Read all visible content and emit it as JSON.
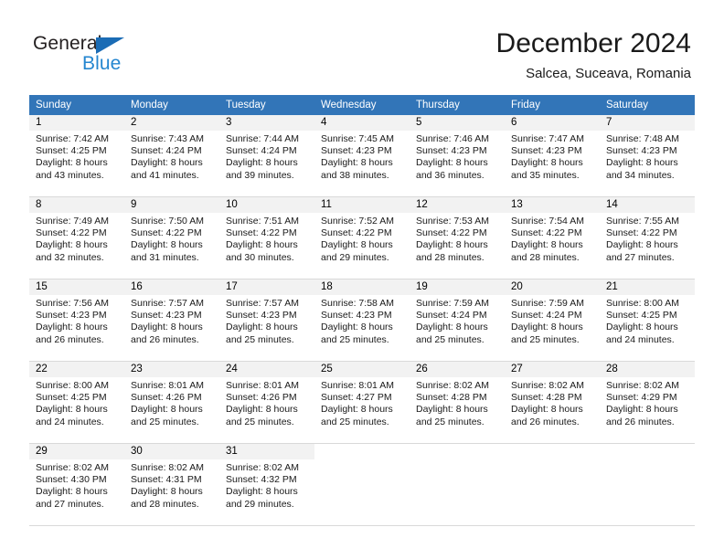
{
  "brand": {
    "name_part1": "General",
    "name_part2": "Blue",
    "triangle_color": "#1b6cb5",
    "blue_color": "#2486d0"
  },
  "header": {
    "title": "December 2024",
    "subtitle": "Salcea, Suceava, Romania",
    "header_bg_color": "#3275b8",
    "daynum_bg_color": "#f2f2f2"
  },
  "weekdays": [
    "Sunday",
    "Monday",
    "Tuesday",
    "Wednesday",
    "Thursday",
    "Friday",
    "Saturday"
  ],
  "labels": {
    "sunrise_prefix": "Sunrise:",
    "sunset_prefix": "Sunset:",
    "daylight_prefix": "Daylight:"
  },
  "weeks": [
    [
      {
        "day": "1",
        "sunrise": "Sunrise: 7:42 AM",
        "sunset": "Sunset: 4:25 PM",
        "daylight_l1": "Daylight: 8 hours",
        "daylight_l2": "and 43 minutes."
      },
      {
        "day": "2",
        "sunrise": "Sunrise: 7:43 AM",
        "sunset": "Sunset: 4:24 PM",
        "daylight_l1": "Daylight: 8 hours",
        "daylight_l2": "and 41 minutes."
      },
      {
        "day": "3",
        "sunrise": "Sunrise: 7:44 AM",
        "sunset": "Sunset: 4:24 PM",
        "daylight_l1": "Daylight: 8 hours",
        "daylight_l2": "and 39 minutes."
      },
      {
        "day": "4",
        "sunrise": "Sunrise: 7:45 AM",
        "sunset": "Sunset: 4:23 PM",
        "daylight_l1": "Daylight: 8 hours",
        "daylight_l2": "and 38 minutes."
      },
      {
        "day": "5",
        "sunrise": "Sunrise: 7:46 AM",
        "sunset": "Sunset: 4:23 PM",
        "daylight_l1": "Daylight: 8 hours",
        "daylight_l2": "and 36 minutes."
      },
      {
        "day": "6",
        "sunrise": "Sunrise: 7:47 AM",
        "sunset": "Sunset: 4:23 PM",
        "daylight_l1": "Daylight: 8 hours",
        "daylight_l2": "and 35 minutes."
      },
      {
        "day": "7",
        "sunrise": "Sunrise: 7:48 AM",
        "sunset": "Sunset: 4:23 PM",
        "daylight_l1": "Daylight: 8 hours",
        "daylight_l2": "and 34 minutes."
      }
    ],
    [
      {
        "day": "8",
        "sunrise": "Sunrise: 7:49 AM",
        "sunset": "Sunset: 4:22 PM",
        "daylight_l1": "Daylight: 8 hours",
        "daylight_l2": "and 32 minutes."
      },
      {
        "day": "9",
        "sunrise": "Sunrise: 7:50 AM",
        "sunset": "Sunset: 4:22 PM",
        "daylight_l1": "Daylight: 8 hours",
        "daylight_l2": "and 31 minutes."
      },
      {
        "day": "10",
        "sunrise": "Sunrise: 7:51 AM",
        "sunset": "Sunset: 4:22 PM",
        "daylight_l1": "Daylight: 8 hours",
        "daylight_l2": "and 30 minutes."
      },
      {
        "day": "11",
        "sunrise": "Sunrise: 7:52 AM",
        "sunset": "Sunset: 4:22 PM",
        "daylight_l1": "Daylight: 8 hours",
        "daylight_l2": "and 29 minutes."
      },
      {
        "day": "12",
        "sunrise": "Sunrise: 7:53 AM",
        "sunset": "Sunset: 4:22 PM",
        "daylight_l1": "Daylight: 8 hours",
        "daylight_l2": "and 28 minutes."
      },
      {
        "day": "13",
        "sunrise": "Sunrise: 7:54 AM",
        "sunset": "Sunset: 4:22 PM",
        "daylight_l1": "Daylight: 8 hours",
        "daylight_l2": "and 28 minutes."
      },
      {
        "day": "14",
        "sunrise": "Sunrise: 7:55 AM",
        "sunset": "Sunset: 4:22 PM",
        "daylight_l1": "Daylight: 8 hours",
        "daylight_l2": "and 27 minutes."
      }
    ],
    [
      {
        "day": "15",
        "sunrise": "Sunrise: 7:56 AM",
        "sunset": "Sunset: 4:23 PM",
        "daylight_l1": "Daylight: 8 hours",
        "daylight_l2": "and 26 minutes."
      },
      {
        "day": "16",
        "sunrise": "Sunrise: 7:57 AM",
        "sunset": "Sunset: 4:23 PM",
        "daylight_l1": "Daylight: 8 hours",
        "daylight_l2": "and 26 minutes."
      },
      {
        "day": "17",
        "sunrise": "Sunrise: 7:57 AM",
        "sunset": "Sunset: 4:23 PM",
        "daylight_l1": "Daylight: 8 hours",
        "daylight_l2": "and 25 minutes."
      },
      {
        "day": "18",
        "sunrise": "Sunrise: 7:58 AM",
        "sunset": "Sunset: 4:23 PM",
        "daylight_l1": "Daylight: 8 hours",
        "daylight_l2": "and 25 minutes."
      },
      {
        "day": "19",
        "sunrise": "Sunrise: 7:59 AM",
        "sunset": "Sunset: 4:24 PM",
        "daylight_l1": "Daylight: 8 hours",
        "daylight_l2": "and 25 minutes."
      },
      {
        "day": "20",
        "sunrise": "Sunrise: 7:59 AM",
        "sunset": "Sunset: 4:24 PM",
        "daylight_l1": "Daylight: 8 hours",
        "daylight_l2": "and 25 minutes."
      },
      {
        "day": "21",
        "sunrise": "Sunrise: 8:00 AM",
        "sunset": "Sunset: 4:25 PM",
        "daylight_l1": "Daylight: 8 hours",
        "daylight_l2": "and 24 minutes."
      }
    ],
    [
      {
        "day": "22",
        "sunrise": "Sunrise: 8:00 AM",
        "sunset": "Sunset: 4:25 PM",
        "daylight_l1": "Daylight: 8 hours",
        "daylight_l2": "and 24 minutes."
      },
      {
        "day": "23",
        "sunrise": "Sunrise: 8:01 AM",
        "sunset": "Sunset: 4:26 PM",
        "daylight_l1": "Daylight: 8 hours",
        "daylight_l2": "and 25 minutes."
      },
      {
        "day": "24",
        "sunrise": "Sunrise: 8:01 AM",
        "sunset": "Sunset: 4:26 PM",
        "daylight_l1": "Daylight: 8 hours",
        "daylight_l2": "and 25 minutes."
      },
      {
        "day": "25",
        "sunrise": "Sunrise: 8:01 AM",
        "sunset": "Sunset: 4:27 PM",
        "daylight_l1": "Daylight: 8 hours",
        "daylight_l2": "and 25 minutes."
      },
      {
        "day": "26",
        "sunrise": "Sunrise: 8:02 AM",
        "sunset": "Sunset: 4:28 PM",
        "daylight_l1": "Daylight: 8 hours",
        "daylight_l2": "and 25 minutes."
      },
      {
        "day": "27",
        "sunrise": "Sunrise: 8:02 AM",
        "sunset": "Sunset: 4:28 PM",
        "daylight_l1": "Daylight: 8 hours",
        "daylight_l2": "and 26 minutes."
      },
      {
        "day": "28",
        "sunrise": "Sunrise: 8:02 AM",
        "sunset": "Sunset: 4:29 PM",
        "daylight_l1": "Daylight: 8 hours",
        "daylight_l2": "and 26 minutes."
      }
    ],
    [
      {
        "day": "29",
        "sunrise": "Sunrise: 8:02 AM",
        "sunset": "Sunset: 4:30 PM",
        "daylight_l1": "Daylight: 8 hours",
        "daylight_l2": "and 27 minutes."
      },
      {
        "day": "30",
        "sunrise": "Sunrise: 8:02 AM",
        "sunset": "Sunset: 4:31 PM",
        "daylight_l1": "Daylight: 8 hours",
        "daylight_l2": "and 28 minutes."
      },
      {
        "day": "31",
        "sunrise": "Sunrise: 8:02 AM",
        "sunset": "Sunset: 4:32 PM",
        "daylight_l1": "Daylight: 8 hours",
        "daylight_l2": "and 29 minutes."
      },
      {
        "day": "",
        "sunrise": "",
        "sunset": "",
        "daylight_l1": "",
        "daylight_l2": ""
      },
      {
        "day": "",
        "sunrise": "",
        "sunset": "",
        "daylight_l1": "",
        "daylight_l2": ""
      },
      {
        "day": "",
        "sunrise": "",
        "sunset": "",
        "daylight_l1": "",
        "daylight_l2": ""
      },
      {
        "day": "",
        "sunrise": "",
        "sunset": "",
        "daylight_l1": "",
        "daylight_l2": ""
      }
    ]
  ]
}
